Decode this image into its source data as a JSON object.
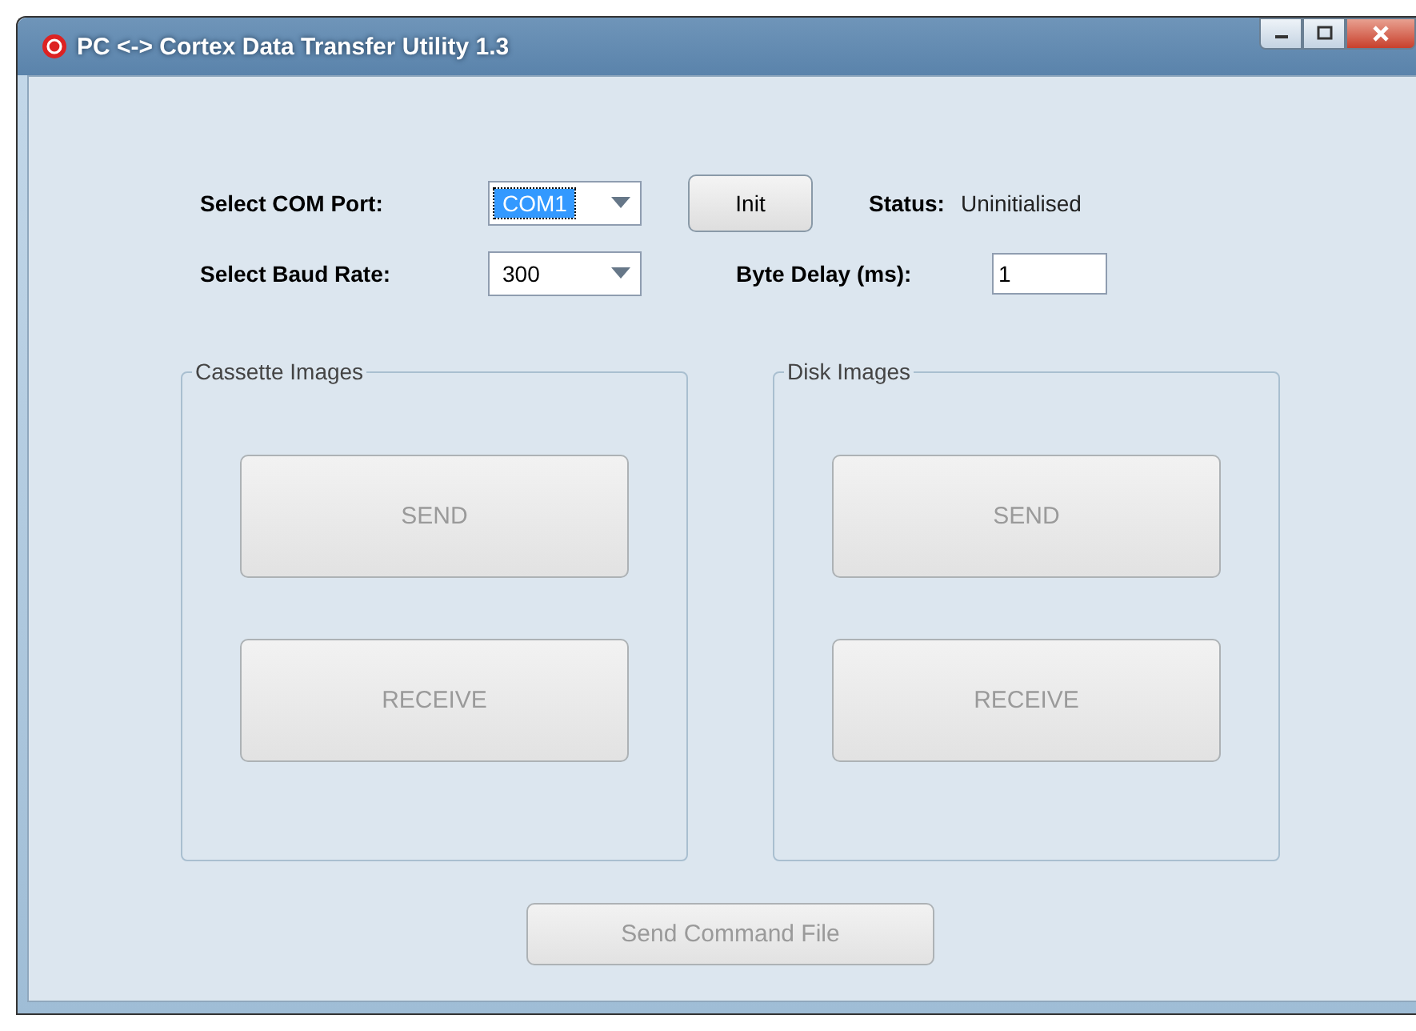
{
  "window": {
    "title": "PC <-> Cortex Data Transfer Utility 1.3"
  },
  "com_port": {
    "label": "Select COM Port:",
    "value": "COM1",
    "focused": true
  },
  "init_button": {
    "label": "Init",
    "disabled": false
  },
  "status": {
    "label": "Status:",
    "value": "Uninitialised"
  },
  "baud_rate": {
    "label": "Select Baud Rate:",
    "value": "300",
    "focused": false
  },
  "byte_delay": {
    "label": "Byte Delay (ms):",
    "value": "1"
  },
  "groups": [
    {
      "title": "Cassette Images",
      "buttons": [
        {
          "label": "SEND",
          "disabled": true
        },
        {
          "label": "RECEIVE",
          "disabled": true
        }
      ]
    },
    {
      "title": "Disk Images",
      "buttons": [
        {
          "label": "SEND",
          "disabled": true
        },
        {
          "label": "RECEIVE",
          "disabled": true
        }
      ]
    }
  ],
  "send_command_file": {
    "label": "Send Command File",
    "disabled": true
  }
}
